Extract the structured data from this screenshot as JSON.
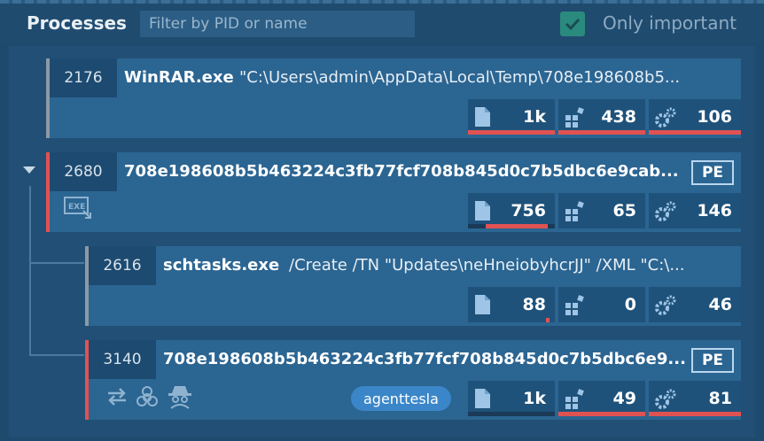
{
  "header": {
    "title": "Processes",
    "filter_placeholder": "Filter by PID or name",
    "only_important_label": "Only important",
    "only_important_checked": true
  },
  "processes": [
    {
      "pid": "2176",
      "name": "WinRAR.exe",
      "cmd": "\"C:\\Users\\admin\\AppData\\Local\\Temp\\708e198608b5...",
      "files": "1k",
      "registry": "438",
      "modules": "106",
      "pe": false,
      "tag": ""
    },
    {
      "pid": "2680",
      "name": "708e198608b5b463224c3fb77fcf708b845d0c7b5dbc6e9cab...",
      "cmd": "",
      "files": "756",
      "registry": "65",
      "modules": "146",
      "pe": true,
      "pe_label": "PE",
      "tag": ""
    },
    {
      "pid": "2616",
      "name": "schtasks.exe",
      "cmd": "/Create /TN \"Updates\\neHneiobyhcrJJ\" /XML \"C:\\...",
      "files": "88",
      "registry": "0",
      "modules": "46",
      "pe": false,
      "tag": ""
    },
    {
      "pid": "3140",
      "name": "708e198608b5b463224c3fb77fcf708b845d0c7b5dbc6e9...",
      "cmd": "",
      "files": "1k",
      "registry": "49",
      "modules": "81",
      "pe": true,
      "pe_label": "PE",
      "tag": "agenttesla"
    }
  ],
  "colors": {
    "danger": "#e05252",
    "neutral": "#8c99a4",
    "track": "#1a3a57",
    "background": "#1e4a6e"
  }
}
